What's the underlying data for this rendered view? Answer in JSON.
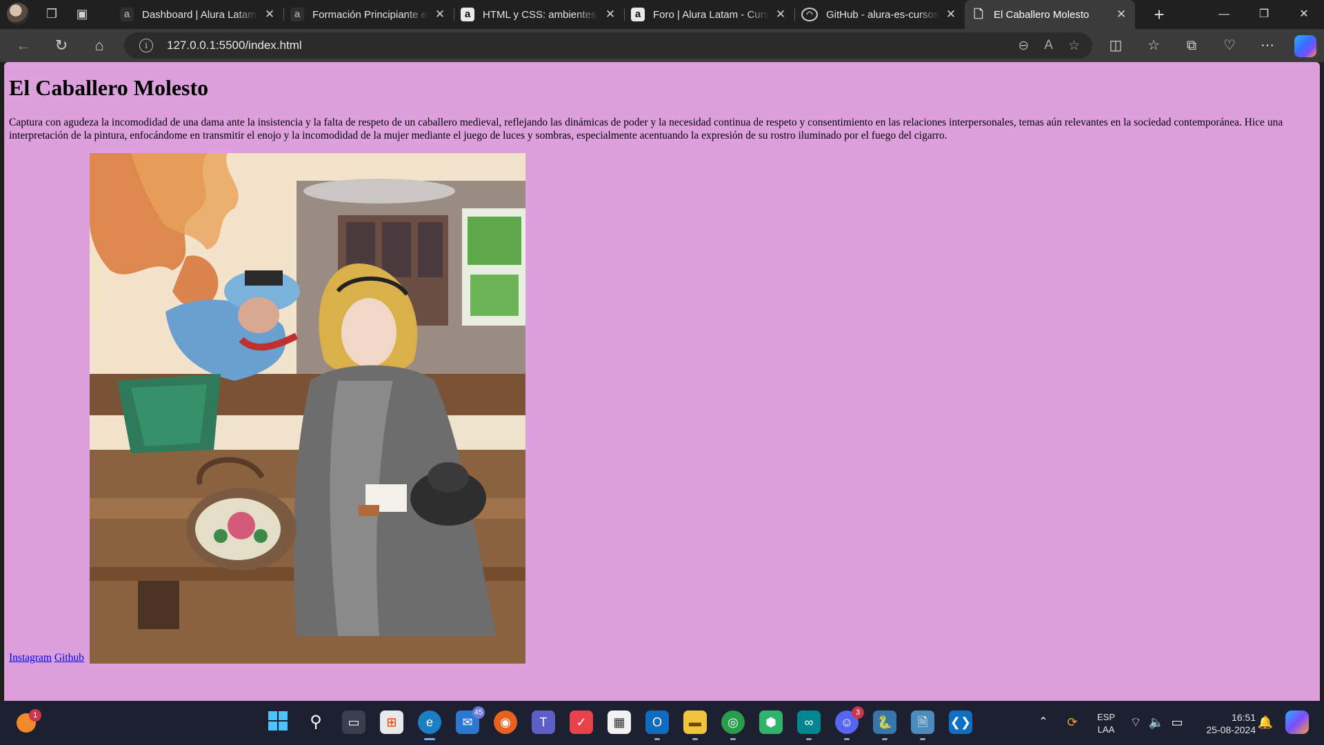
{
  "browser": {
    "tabs": [
      {
        "title": "Dashboard | Alura Latam",
        "favicon": "alura-icon",
        "active": false
      },
      {
        "title": "Formación Principiante en",
        "favicon": "alura-icon",
        "active": false
      },
      {
        "title": "HTML y CSS: ambientes de",
        "favicon": "alura-icon",
        "active": false
      },
      {
        "title": "Foro | Alura Latam - Curso",
        "favicon": "alura-icon",
        "active": false
      },
      {
        "title": "GitHub - alura-es-cursos/",
        "favicon": "github-icon",
        "active": false
      },
      {
        "title": "El Caballero Molesto",
        "favicon": "document-icon",
        "active": true
      }
    ],
    "address_url": "127.0.0.1:5500/index.html",
    "accent_color": "#dda0dd"
  },
  "page": {
    "heading": "El Caballero Molesto",
    "description": "Captura con agudeza la incomodidad de una dama ante la insistencia y la falta de respeto de un caballero medieval, reflejando las dinámicas de poder y la necesidad continua de respeto y consentimiento en las relaciones interpersonales, temas aún relevantes en la sociedad contemporánea. Hice una interpretación de la pintura, enfocándome en transmitir el enojo y la incomodidad de la mujer mediante el juego de luces y sombras, especialmente acentuando la expresión de su rostro iluminado por el fuego del cigarro.",
    "links": {
      "instagram": "Instagram",
      "github": "Github"
    },
    "background_color": "#dda0dd"
  },
  "taskbar": {
    "badges": {
      "notifications_app": "1",
      "mail": "45",
      "discord": "3"
    },
    "language": {
      "line1": "ESP",
      "line2": "LAA"
    },
    "clock": {
      "time": "16:51",
      "date": "25-08-2024"
    }
  }
}
